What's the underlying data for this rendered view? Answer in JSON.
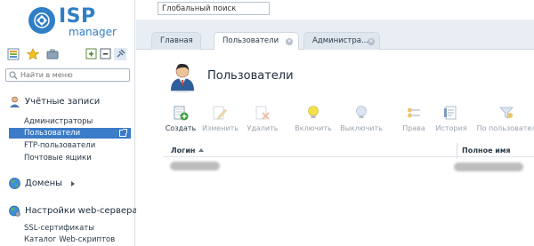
{
  "logo": {
    "name": "ISP",
    "sub": "manager"
  },
  "sidebar": {
    "search_placeholder": "Найти в меню",
    "sections": [
      {
        "title": "Учётные записи",
        "items": [
          "Администраторы",
          "Пользователи",
          "FTP-пользователи",
          "Почтовые ящики"
        ],
        "active_item": "Пользователи"
      },
      {
        "title": "Домены",
        "items": []
      },
      {
        "title": "Настройки web-сервера",
        "items": [
          "SSL-сертификаты",
          "Каталог Web-скриптов"
        ]
      }
    ]
  },
  "global_search": {
    "value": "Глобальный поиск"
  },
  "tabs": [
    {
      "label": "Главная",
      "closable": false,
      "active": false
    },
    {
      "label": "Пользователи",
      "closable": true,
      "active": true
    },
    {
      "label": "Администра...",
      "closable": true,
      "active": false
    }
  ],
  "page": {
    "title": "Пользователи"
  },
  "toolbar": [
    {
      "label": "Создать",
      "icon": "user-add-icon",
      "enabled": true
    },
    {
      "label": "Изменить",
      "icon": "edit-icon",
      "enabled": false
    },
    {
      "label": "Удалить",
      "icon": "delete-icon",
      "enabled": false
    },
    {
      "label": "Включить",
      "icon": "lightbulb-on-icon",
      "enabled": false
    },
    {
      "label": "Выключить",
      "icon": "lightbulb-off-icon",
      "enabled": false
    },
    {
      "label": "Права",
      "icon": "permissions-icon",
      "enabled": false
    },
    {
      "label": "История",
      "icon": "history-icon",
      "enabled": false
    },
    {
      "label": "По пользовател",
      "icon": "filter-user-icon",
      "enabled": false
    }
  ],
  "table": {
    "columns": [
      "Логин",
      "Полное имя"
    ],
    "sort_column": "Логин",
    "rows": [
      {
        "login": "",
        "full_name": ""
      }
    ]
  },
  "colors": {
    "brand": "#2f7fc7",
    "active_nav": "#3b7bc8",
    "tab_bar": "#e9eef4"
  }
}
